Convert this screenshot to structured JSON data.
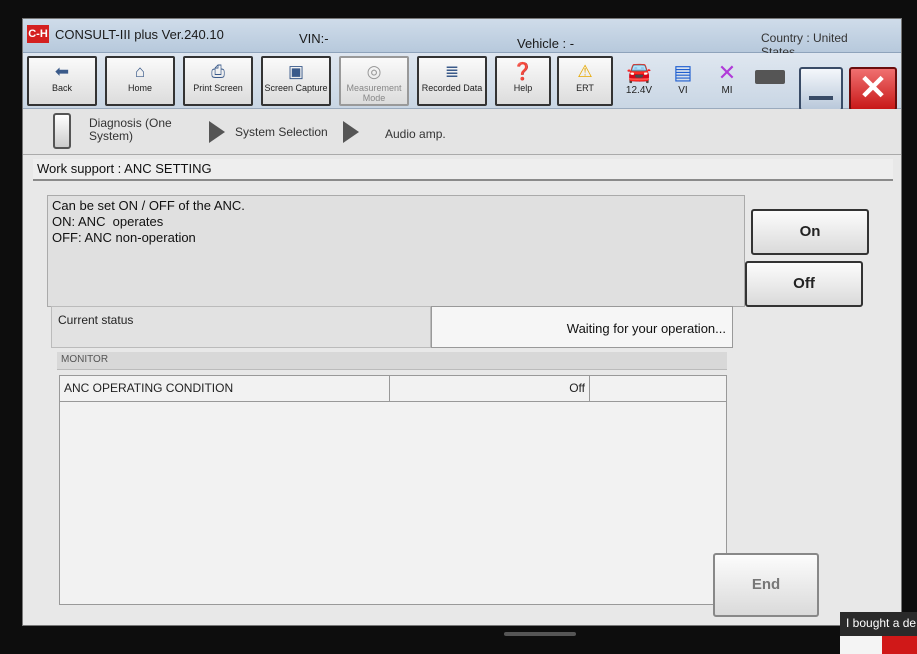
{
  "titlebar": {
    "logo": "C-H",
    "app_title": "CONSULT-III plus  Ver.240.10",
    "vin": "VIN:-",
    "vehicle": "Vehicle : -",
    "country": "Country : United States"
  },
  "toolbar": {
    "back": "Back",
    "home": "Home",
    "print_screen": "Print Screen",
    "screen_capture": "Screen Capture",
    "measurement_mode": "Measurement Mode",
    "recorded_data": "Recorded Data",
    "help": "Help",
    "ert": "ERT",
    "voltage": "12.4V",
    "vi": "VI",
    "mi": "MI",
    "icons": {
      "back": "back-arrow-icon",
      "home": "home-icon",
      "print": "printer-icon",
      "capture": "camera-icon",
      "measurement": "meter-icon",
      "recorded": "recorded-data-icon",
      "help": "help-icon",
      "ert": "warning-icon",
      "vehicle": "car-icon",
      "vi": "vi-icon",
      "mi": "mi-icon",
      "battery": "battery-icon"
    }
  },
  "breadcrumb": {
    "diagnosis": "Diagnosis (One System)",
    "system_selection": "System Selection",
    "audio_amp": "Audio amp."
  },
  "work_support": {
    "header": "Work support : ANC SETTING",
    "description": [
      "Can be set ON / OFF of the ANC.",
      "ON: ANC  operates",
      "OFF: ANC non-operation"
    ]
  },
  "actions": {
    "on": "On",
    "off": "Off",
    "end": "End"
  },
  "status": {
    "label": "Current status",
    "value": "Waiting for your operation..."
  },
  "monitor": {
    "header": "MONITOR",
    "rows": [
      {
        "item": "ANC OPERATING CONDITION",
        "value": "Off",
        "unit": ""
      }
    ]
  },
  "overlay": {
    "caption": "I bought a de"
  }
}
